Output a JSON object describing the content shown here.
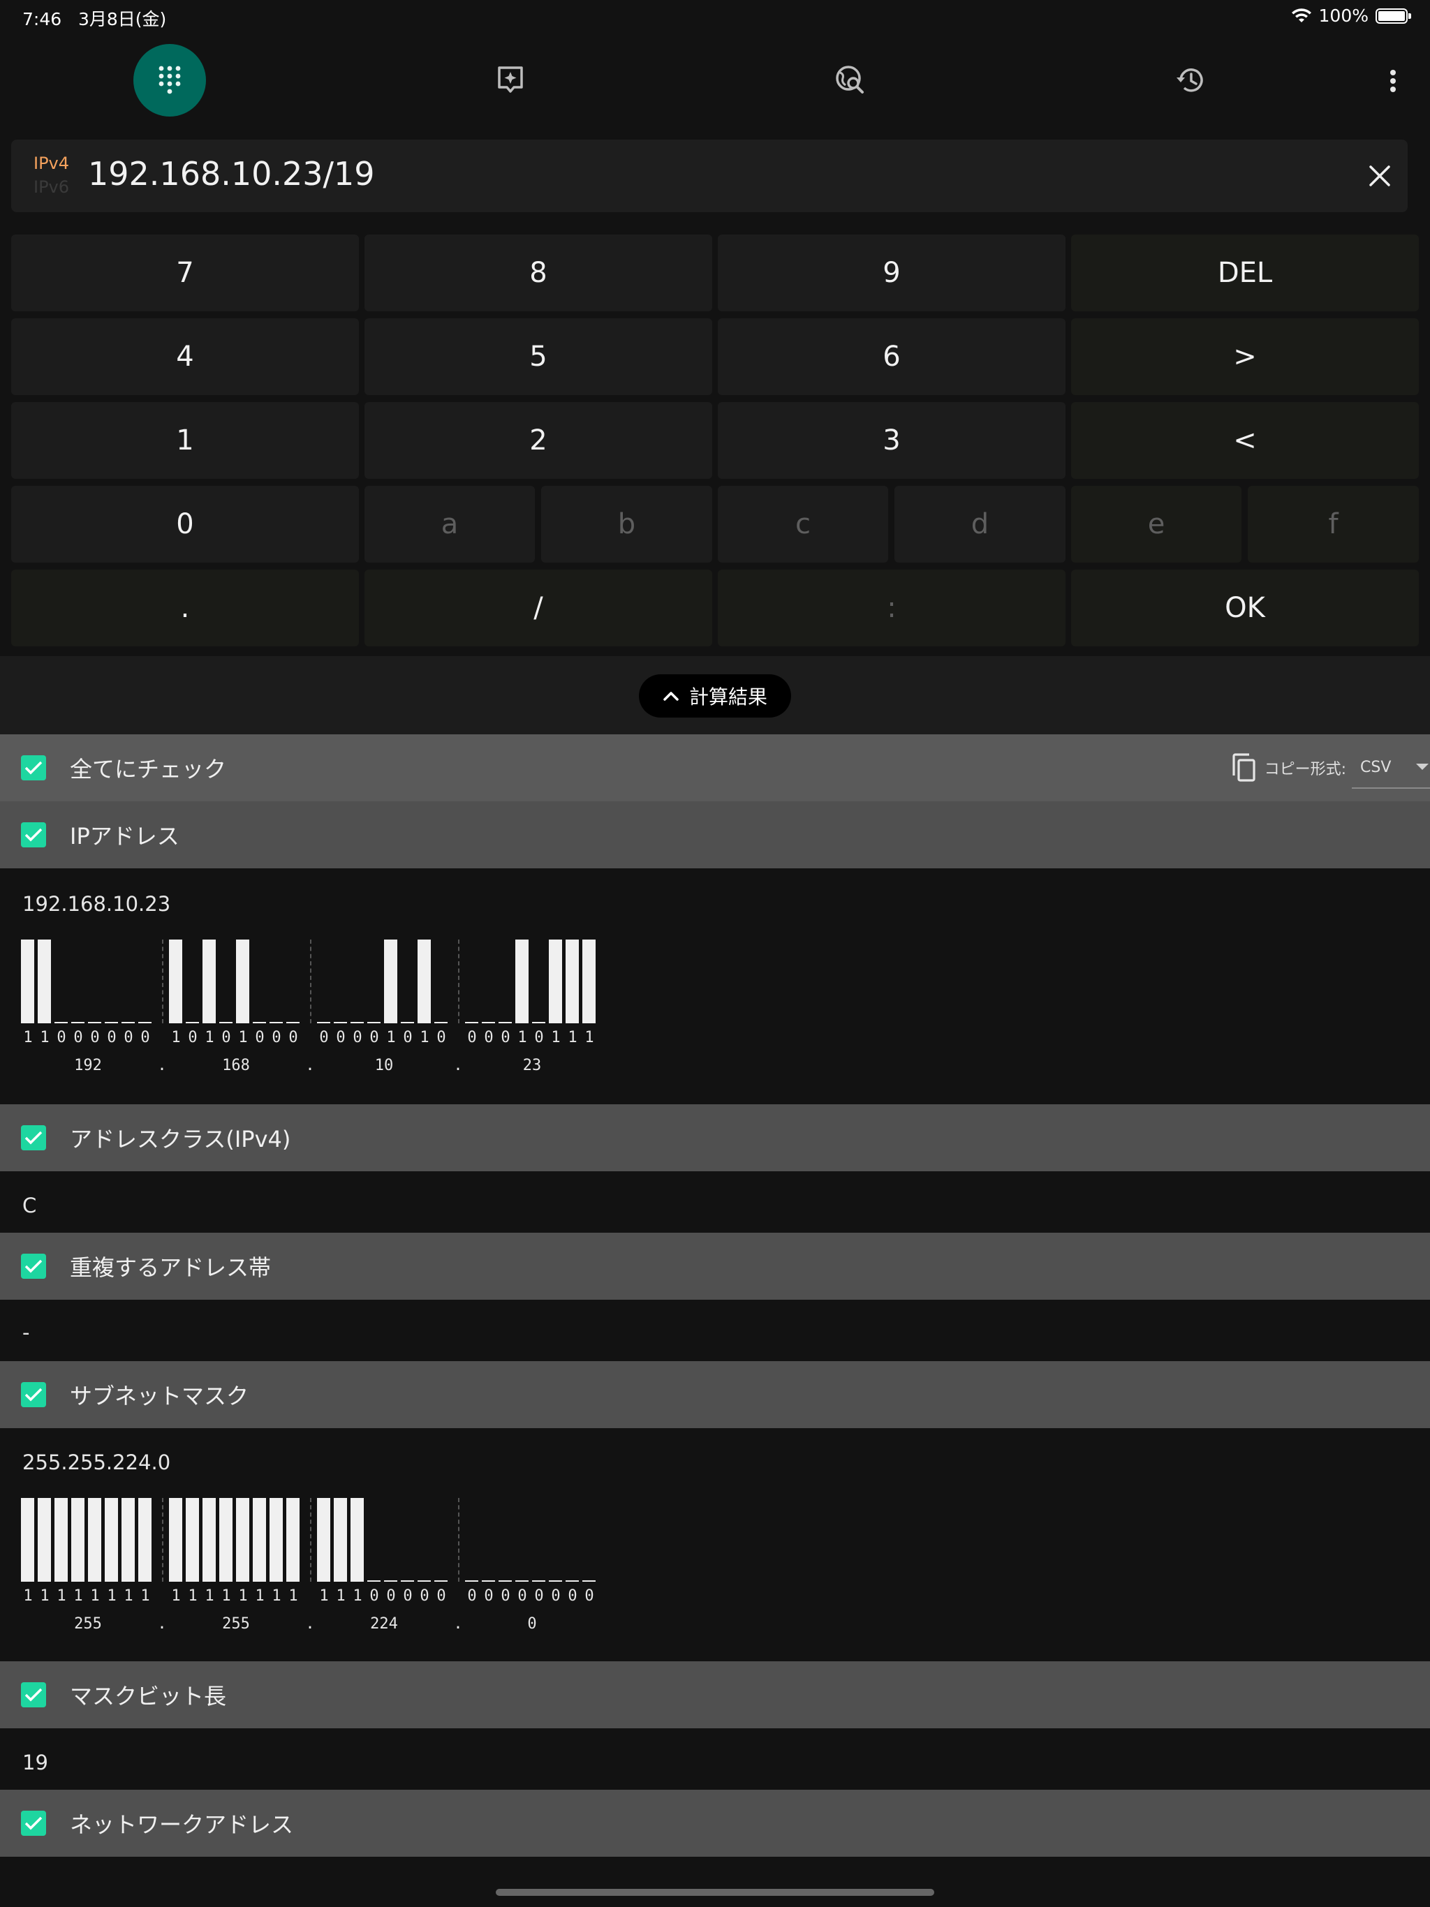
{
  "status": {
    "time": "7:46",
    "date": "3月8日(金)",
    "battery": "100%"
  },
  "nav": {
    "tabs": [
      {
        "icon": "dialpad-icon",
        "active": true
      },
      {
        "icon": "sparkle-bubble-icon",
        "active": false
      },
      {
        "icon": "globe-search-icon",
        "active": false
      },
      {
        "icon": "history-icon",
        "active": false
      }
    ],
    "more_icon": "more-vert-icon"
  },
  "input": {
    "ipv4_label": "IPv4",
    "ipv6_label": "IPv6",
    "value": "192.168.10.23/19"
  },
  "keypad": {
    "keys": [
      "7",
      "8",
      "9",
      "DEL",
      "4",
      "5",
      "6",
      ">",
      "1",
      "2",
      "3",
      "<",
      "0",
      "a",
      "b",
      "c",
      "d",
      "e",
      "f",
      ".",
      "/",
      ":",
      "OK"
    ]
  },
  "results_toggle": {
    "label": "計算結果"
  },
  "copy": {
    "label": "コピー形式:",
    "format": "CSV"
  },
  "sections": {
    "check_all": "全てにチェック",
    "ip_address": {
      "label": "IPアドレス",
      "value": "192.168.10.23",
      "octets": [
        {
          "decimal": "192",
          "bits": "11000000"
        },
        {
          "decimal": "168",
          "bits": "10101000"
        },
        {
          "decimal": "10",
          "bits": "00001010"
        },
        {
          "decimal": "23",
          "bits": "00010111"
        }
      ]
    },
    "address_class": {
      "label": "アドレスクラス(IPv4)",
      "value": "C"
    },
    "overlap": {
      "label": "重複するアドレス帯",
      "value": "-"
    },
    "subnet_mask": {
      "label": "サブネットマスク",
      "value": "255.255.224.0",
      "octets": [
        {
          "decimal": "255",
          "bits": "11111111"
        },
        {
          "decimal": "255",
          "bits": "11111111"
        },
        {
          "decimal": "224",
          "bits": "11100000"
        },
        {
          "decimal": "0",
          "bits": "00000000"
        }
      ]
    },
    "mask_bits": {
      "label": "マスクビット長",
      "value": "19"
    },
    "network_address": {
      "label": "ネットワークアドレス"
    },
    "dot": "."
  },
  "colors": {
    "accent": "#1ed6a0",
    "nav_active": "#00695c",
    "ipv4_tag": "#f5a25d"
  }
}
